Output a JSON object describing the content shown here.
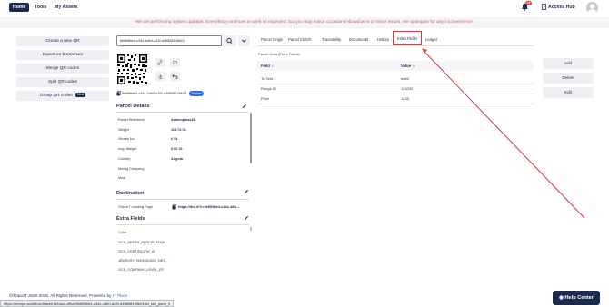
{
  "nav": {
    "tabs": [
      "Home",
      "Tools",
      "My Assets"
    ],
    "notification_count": "24",
    "access_hub_label": "Access Hub"
  },
  "banner_text": "We are performing system updates. Everything continues to work as expected, but you may notice occasional slowdowns or minor issues. We apologize for any inconvenience.",
  "sidebar": {
    "buttons": [
      "Create a new QR",
      "Export on blockchain",
      "Merge QR codes",
      "Split QR codes",
      "Group QR codes"
    ],
    "new_badge": "New"
  },
  "search": {
    "value": "5ef6f6be4-c34c-4db0-a32f-d45858149b01"
  },
  "uuid": {
    "text": "5ef6f6be4-c34c-4db0-a32f-d45858149b01",
    "badge": "Parcel"
  },
  "parcel_details": {
    "title": "Parcel Details",
    "rows": [
      {
        "key": "Parcel Reference",
        "value": "Adamnplasz1B"
      },
      {
        "key": "Weight",
        "value": "118.74 Ct."
      },
      {
        "key": "Stones No.",
        "value": "6 St."
      },
      {
        "key": "Avg. Weight",
        "value": "0.00 Ct."
      },
      {
        "key": "Country",
        "value": "Angola"
      },
      {
        "key": "Mining Company",
        "value": ""
      },
      {
        "key": "Mine",
        "value": ""
      }
    ]
  },
  "destination": {
    "title": "Destination",
    "key": "iTraceiT Landing Page",
    "value": "https://itrc.it/?i=5ef6f6be4-c34c-4db..."
  },
  "extra_fields": {
    "title": "Extra Fields",
    "items": [
      "Color",
      "GCS_DEPTH_PERCENTAGE",
      "GCS_CERTIFICATE_ID",
      "JEWELRY_SHOWCASE_DES...",
      "GCS_COMPANY_LEVEL_EF"
    ]
  },
  "tabs": [
    "Parcel Origin",
    "Parcel Child's",
    "Traceability",
    "Documents",
    "History",
    "Extra Fields",
    "Ledger"
  ],
  "active_tab": "Extra Fields",
  "panel_title": "Parcel Data (Extra Fields)",
  "table": {
    "headers": [
      "Field",
      "Value"
    ],
    "rows": [
      [
        "Tu Test",
        "testtt"
      ],
      [
        "Rough ID",
        "124232"
      ],
      [
        "Price",
        "1245"
      ]
    ]
  },
  "actions": [
    "Add",
    "Delete",
    "Edit"
  ],
  "footer": {
    "copyright": "©iTraceiT 2020-2025. All Rights Reserved. Powered by",
    "powered_by": "IT Place"
  },
  "help_label": "Help Center",
  "status_url": "https://europe-workflow.itraceit.io/back-office/5ef6f6be4-c34c-4db0-a32f-d45858149b01#ct_tab_pane_5",
  "colors": {
    "navy": "#1b2a4a",
    "banner_red": "#e05555",
    "highlight_red": "#e33333",
    "parcel_blue": "#2f6fe0"
  }
}
